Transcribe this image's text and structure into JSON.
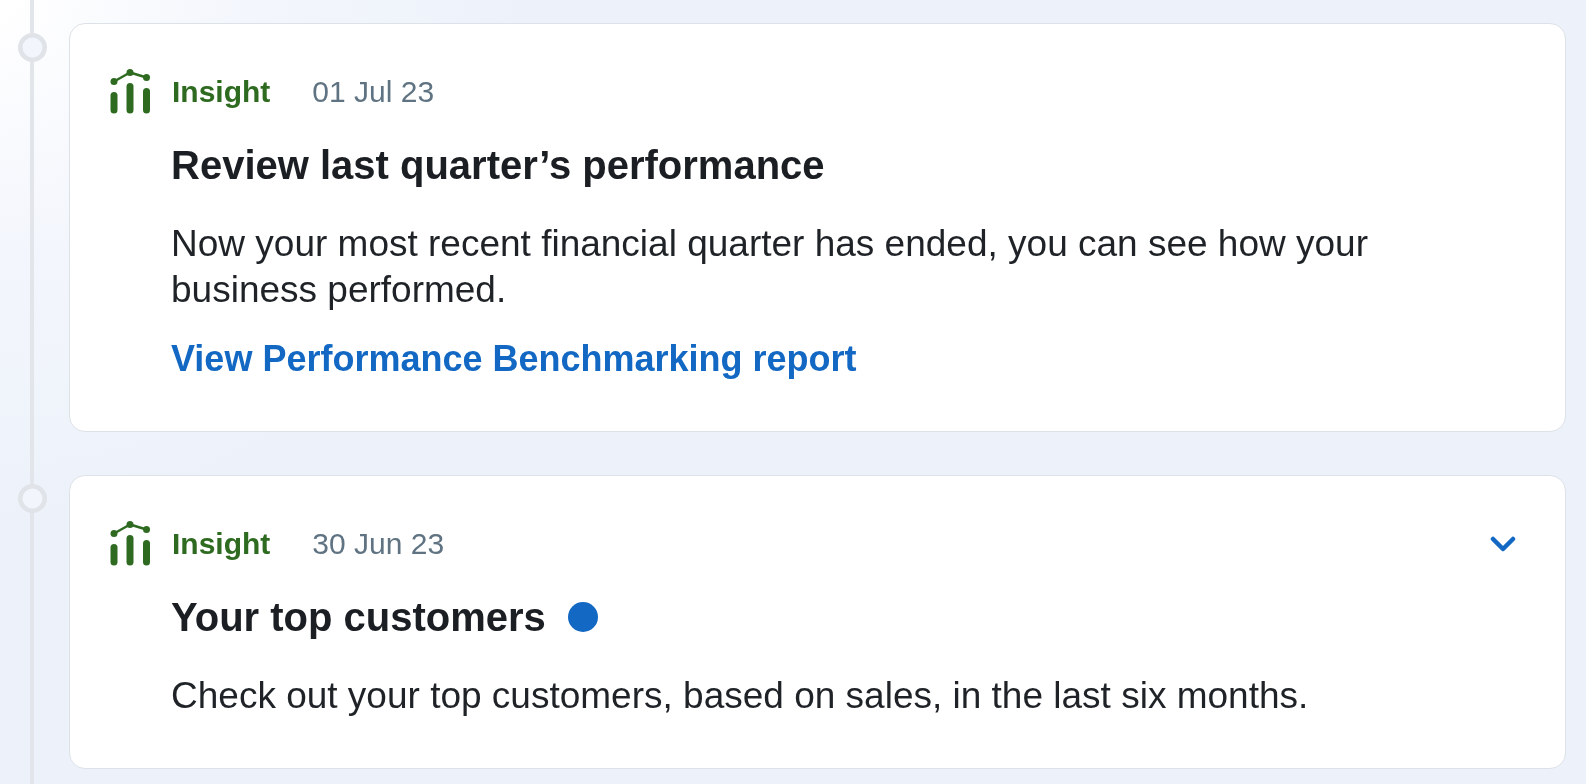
{
  "timeline": {
    "items": [
      {
        "category": "Insight",
        "date": "01 Jul 23",
        "title": "Review last quarter’s performance",
        "unread": false,
        "description": "Now your most recent financial quarter has ended, you can see how your business performed.",
        "link": "View Performance Benchmarking report"
      },
      {
        "category": "Insight",
        "date": "30 Jun 23",
        "title": "Your top customers",
        "unread": true,
        "expanded": false,
        "description": "Check out your top customers, based on sales, in the last six months."
      }
    ]
  }
}
